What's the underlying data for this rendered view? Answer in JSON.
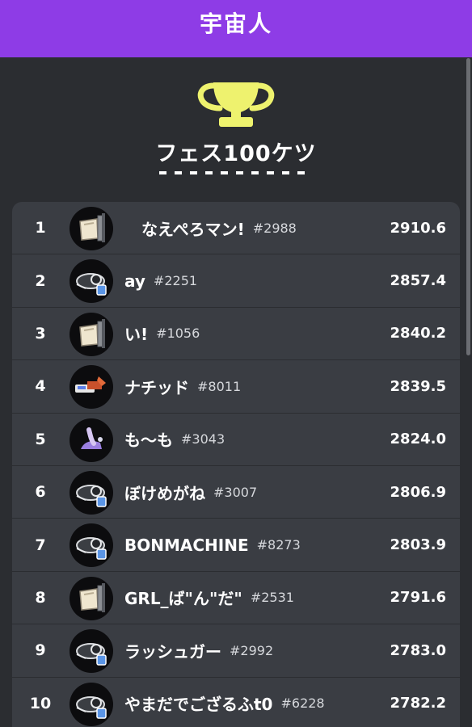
{
  "header": {
    "title": "宇宙人"
  },
  "board": {
    "title": "フェス100ケツ",
    "trophy_icon": "trophy-icon",
    "trophy_color": "#eef26e"
  },
  "colors": {
    "header_bg": "#8e3ce6",
    "page_bg": "#2b2d31",
    "list_bg": "#3a3d43"
  },
  "entries": [
    {
      "rank": "1",
      "name": "なえぺろマン!",
      "tag": "#2988",
      "score": "2910.6",
      "weapon_icon": "splat-roller-icon"
    },
    {
      "rank": "2",
      "name": "ay",
      "tag": "#2251",
      "score": "2857.4",
      "weapon_icon": "splatling-icon"
    },
    {
      "rank": "3",
      "name": "い!",
      "tag": "#1056",
      "score": "2840.2",
      "weapon_icon": "splat-roller-icon"
    },
    {
      "rank": "4",
      "name": "ナチッド",
      "tag": "#8011",
      "score": "2839.5",
      "weapon_icon": "dualie-icon"
    },
    {
      "rank": "5",
      "name": "も〜も",
      "tag": "#3043",
      "score": "2824.0",
      "weapon_icon": "bucket-icon"
    },
    {
      "rank": "6",
      "name": "ぼけめがね",
      "tag": "#3007",
      "score": "2806.9",
      "weapon_icon": "splatling-icon"
    },
    {
      "rank": "7",
      "name": "BONMACHINE",
      "tag": "#8273",
      "score": "2803.9",
      "weapon_icon": "splatling-icon"
    },
    {
      "rank": "8",
      "name": "GRL_ば\"ん\"だ\"",
      "tag": "#2531",
      "score": "2791.6",
      "weapon_icon": "splat-roller-icon"
    },
    {
      "rank": "9",
      "name": "ラッシュガー",
      "tag": "#2992",
      "score": "2783.0",
      "weapon_icon": "splatling-icon"
    },
    {
      "rank": "10",
      "name": "やまだでござるふt0",
      "tag": "#6228",
      "score": "2782.2",
      "weapon_icon": "splatling-icon"
    }
  ]
}
